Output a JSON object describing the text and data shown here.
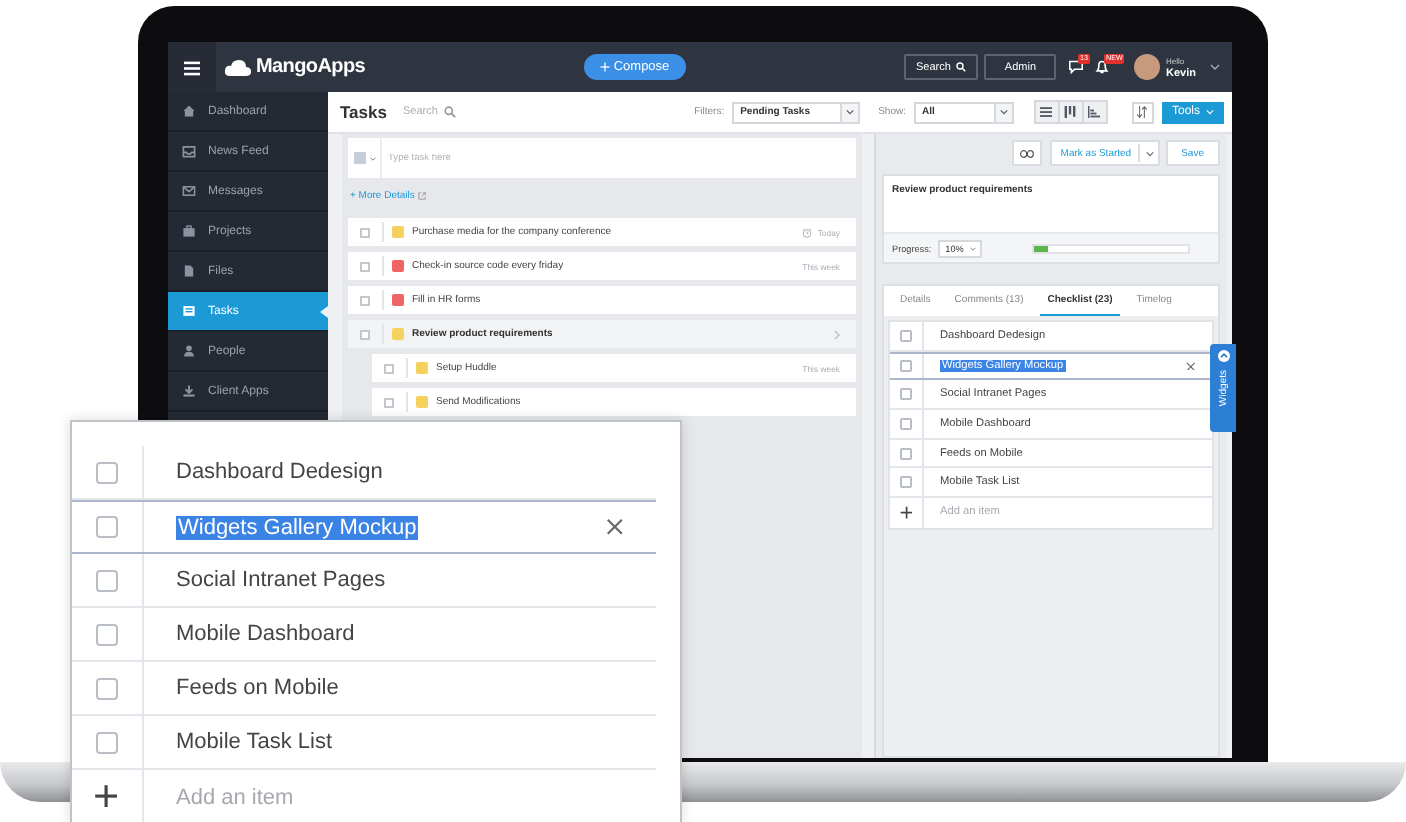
{
  "top_bar": {
    "logo": "MangoApps",
    "compose": "Compose",
    "search": "Search",
    "admin": "Admin",
    "messages_badge": "13",
    "alerts_badge": "NEW",
    "greeting": "Hello",
    "user": "Kevin"
  },
  "sidebar": {
    "items": [
      {
        "label": "Dashboard",
        "selected": false
      },
      {
        "label": "News Feed",
        "selected": false
      },
      {
        "label": "Messages",
        "selected": false
      },
      {
        "label": "Projects",
        "selected": false
      },
      {
        "label": "Files",
        "selected": false
      },
      {
        "label": "Tasks",
        "selected": true
      },
      {
        "label": "People",
        "selected": false
      },
      {
        "label": "Client Apps",
        "selected": false
      }
    ]
  },
  "toolbar": {
    "title": "Tasks",
    "search_placeholder": "Search",
    "filters_label": "Filters:",
    "filter": "Pending Tasks",
    "show_label": "Show:",
    "show": "All",
    "tools": "Tools"
  },
  "new_task": {
    "placeholder": "Type task here"
  },
  "more_details": "+ More Details",
  "tasks": [
    {
      "title": "Purchase media for the company conference",
      "color": "#f5d25e",
      "due": "Today",
      "reminder": true,
      "selected": false,
      "checked": false
    },
    {
      "title": "Check-in source code every friday",
      "color": "#ef6464",
      "due": "This week",
      "reminder": false,
      "selected": false,
      "checked": false
    },
    {
      "title": "Fill in HR forms",
      "color": "#ef6464",
      "reminder": false,
      "selected": false,
      "checked": false
    },
    {
      "title": "Review product requirements",
      "color": "#f5d25e",
      "reminder": false,
      "selected": true,
      "checked": false,
      "children": [
        {
          "title": "Setup Huddle",
          "color": "#f5d25e",
          "due": "This week",
          "reminder": false,
          "selected": false,
          "checked": false
        },
        {
          "title": "Send Modifications",
          "color": "#f5d25e",
          "reminder": false,
          "selected": false,
          "checked": false
        }
      ]
    }
  ],
  "detail": {
    "mark_button": "Mark as Started",
    "save": "Save",
    "title": "Review product requirements",
    "progress_label": "Progress:",
    "progress_value": "10%",
    "level": 0.1
  },
  "tabs": [
    {
      "label": "Details",
      "selected": false
    },
    {
      "label": "Comments (13)",
      "selected": false
    },
    {
      "label": "Checklist (23)",
      "selected": true
    },
    {
      "label": "Timelog",
      "selected": false
    }
  ],
  "checklist": {
    "items": [
      {
        "label": "Dashboard Dedesign",
        "checked": false,
        "editing": false
      },
      {
        "label": "Widgets Gallery Mockup",
        "checked": false,
        "editing": true
      },
      {
        "label": "Social Intranet Pages",
        "checked": false,
        "editing": false
      },
      {
        "label": "Mobile Dashboard",
        "checked": false,
        "editing": false
      },
      {
        "label": "Feeds on Mobile",
        "checked": false,
        "editing": false
      },
      {
        "label": "Mobile Task List",
        "checked": false,
        "editing": false
      }
    ],
    "add_placeholder": "Add an item"
  },
  "widgets_tab": "Widgets",
  "zoom_card": {
    "items": [
      {
        "label": "Dashboard Dedesign",
        "checked": false,
        "editing": false
      },
      {
        "label": "Widgets Gallery Mockup",
        "checked": false,
        "editing": true
      },
      {
        "label": "Social Intranet Pages",
        "checked": false,
        "editing": false
      },
      {
        "label": "Mobile Dashboard",
        "checked": false,
        "editing": false
      },
      {
        "label": "Feeds on Mobile",
        "checked": false,
        "editing": false
      },
      {
        "label": "Mobile Task List",
        "checked": false,
        "editing": false
      }
    ],
    "add_placeholder": "Add an item"
  }
}
